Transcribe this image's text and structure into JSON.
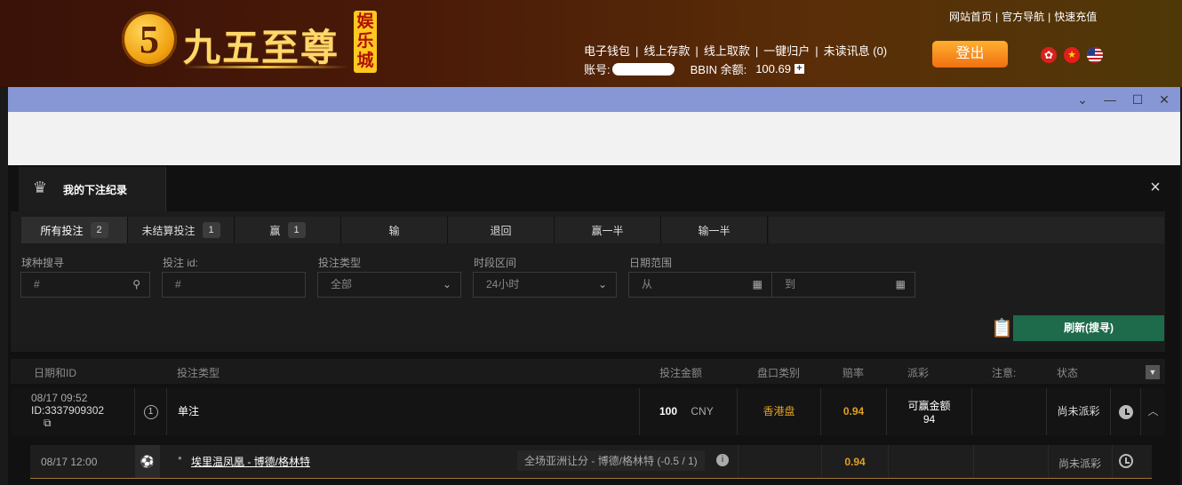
{
  "site": {
    "logo_text": "九五至尊",
    "logo_badge": "娱乐城",
    "top_links": [
      "网站首页",
      "官方导航",
      "快速充值"
    ],
    "account_links": [
      "电子钱包",
      "线上存款",
      "线上取款",
      "一键归户",
      "未读讯息 (0)"
    ],
    "account_label": "账号:",
    "balance_label": "BBIN 余额:",
    "balance_value": "100.69",
    "logout_label": "登出",
    "languages": [
      "hong-kong-flag-icon",
      "china-flag-icon",
      "us-flag-icon"
    ],
    "brand_colors": {
      "header_bg": "#4a1a08",
      "logo_gold": "#ffd86a",
      "logout": "#f08c20"
    }
  },
  "window": {
    "controls": [
      "chevron-down-icon",
      "minimize-icon",
      "maximize-icon",
      "close-icon"
    ],
    "titlebar_color": "#8797d6"
  },
  "panel": {
    "title": "我的下注纪录",
    "close": "×"
  },
  "tabs": [
    {
      "label": "所有投注",
      "count": "2"
    },
    {
      "label": "未结算投注",
      "count": "1"
    },
    {
      "label": "赢",
      "count": "1"
    },
    {
      "label": "输",
      "count": ""
    },
    {
      "label": "退回",
      "count": ""
    },
    {
      "label": "赢一半",
      "count": ""
    },
    {
      "label": "输一半",
      "count": ""
    }
  ],
  "filters": {
    "sport_search": {
      "label": "球种搜寻",
      "placeholder": "#"
    },
    "bet_id": {
      "label": "投注 id:",
      "placeholder": "#"
    },
    "bet_type": {
      "label": "投注类型",
      "value": "全部"
    },
    "period": {
      "label": "时段区间",
      "value": "24小时"
    },
    "date_range": {
      "label": "日期范围",
      "from": "从",
      "to": "到"
    },
    "refresh_label": "刷新(搜寻)"
  },
  "table": {
    "headers": [
      "日期和ID",
      "投注类型",
      "投注金额",
      "盘口类别",
      "赔率",
      "派彩",
      "注意:",
      "状态"
    ],
    "bet": {
      "datetime": "08/17 09:52",
      "id": "ID:3337909302",
      "index": "1",
      "type": "单注",
      "amount": "100",
      "currency": "CNY",
      "odds_type": "香港盘",
      "odds": "0.94",
      "payout_label": "可赢金额",
      "payout_value": "94",
      "status": "尚未派彩"
    },
    "selection": {
      "datetime": "08/17 12:00",
      "match": "埃里温凤凰 - 博德/格林特",
      "market": "全场亚洲让分 - 博德/格林特 (-0.5 / 1)",
      "odds": "0.94",
      "status": "尚未派彩"
    }
  }
}
